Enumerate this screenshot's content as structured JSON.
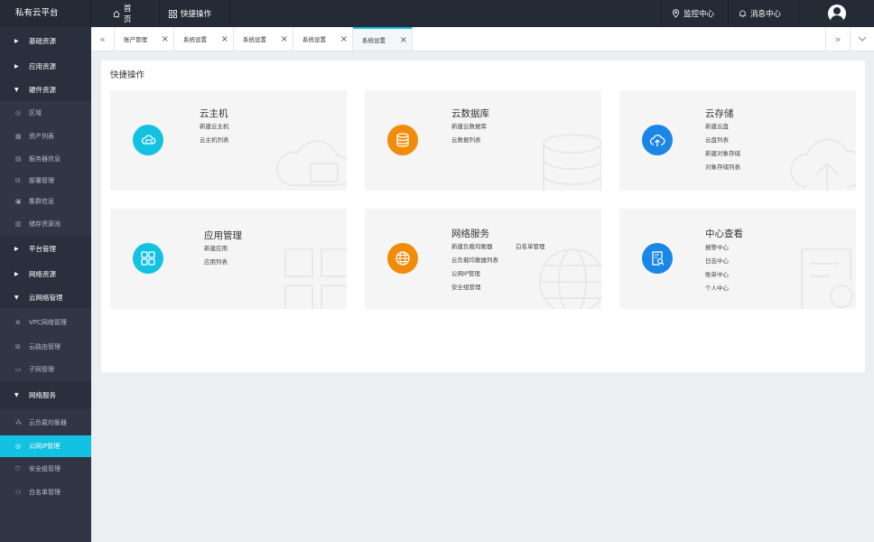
{
  "app": {
    "title": "私有云平台"
  },
  "topnav": {
    "home": "首页",
    "quick": "快捷操作",
    "monitor": "监控中心",
    "messages": "消息中心"
  },
  "sidebar": {
    "items": [
      {
        "type": "group",
        "label": "基础资源",
        "expanded": false
      },
      {
        "type": "group",
        "label": "应用资源",
        "expanded": false
      },
      {
        "type": "group",
        "label": "硬件资源",
        "expanded": true
      },
      {
        "type": "item",
        "label": "区域",
        "icon": "region-icon"
      },
      {
        "type": "item",
        "label": "资产列表",
        "icon": "asset-icon"
      },
      {
        "type": "item",
        "label": "服务器信息",
        "icon": "server-icon"
      },
      {
        "type": "item",
        "label": "部署管理",
        "icon": "deploy-icon"
      },
      {
        "type": "item",
        "label": "集群信息",
        "icon": "cluster-icon"
      },
      {
        "type": "item",
        "label": "储存资源池",
        "icon": "storage-pool-icon"
      },
      {
        "type": "group",
        "label": "平台管理",
        "expanded": false
      },
      {
        "type": "group",
        "label": "网络资源",
        "expanded": false
      },
      {
        "type": "group",
        "label": "云网络管理",
        "expanded": true
      },
      {
        "type": "item",
        "label": "VPC网络管理",
        "icon": "vpc-icon"
      },
      {
        "type": "item",
        "label": "云路由管理",
        "icon": "router-icon"
      },
      {
        "type": "item",
        "label": "子网管理",
        "icon": "subnet-icon"
      },
      {
        "type": "group",
        "label": "网络服务",
        "expanded": true
      },
      {
        "type": "item",
        "label": "云负载均衡器",
        "icon": "load-balancer-icon"
      },
      {
        "type": "item",
        "label": "公网IP管理",
        "icon": "public-ip-icon",
        "active": true
      },
      {
        "type": "item",
        "label": "安全组管理",
        "icon": "security-group-icon"
      },
      {
        "type": "item",
        "label": "白名单管理",
        "icon": "whitelist-icon"
      }
    ]
  },
  "tabs": [
    {
      "label": "账户管理"
    },
    {
      "label": "系统设置"
    },
    {
      "label": "系统设置"
    },
    {
      "label": "系统设置"
    },
    {
      "label": "系统设置",
      "active": true
    }
  ],
  "main": {
    "title": "快捷操作",
    "cards": [
      {
        "title": "云主机",
        "icon": "cloud-host-icon",
        "color": "#13c1e2",
        "links": [
          "新建云主机",
          "云主机列表"
        ]
      },
      {
        "title": "云数据库",
        "icon": "database-icon",
        "color": "#f08c0a",
        "links": [
          "新建云数据库",
          "云数据列表"
        ]
      },
      {
        "title": "云存储",
        "icon": "cloud-storage-icon",
        "color": "#1a86e6",
        "links": [
          "新建云盘",
          "云盘列表",
          "新建对象存储",
          "对象存储列表"
        ]
      },
      {
        "title": "应用管理",
        "icon": "app-grid-icon",
        "color": "#13c1e2",
        "links": [
          "新建应用",
          "应用列表"
        ]
      },
      {
        "title": "网络服务",
        "icon": "globe-icon",
        "color": "#f08c0a",
        "links": [
          "新建负载均衡器",
          "云负载均衡器列表",
          "公网IP管理",
          "安全组管理"
        ],
        "extra_link": "白名单管理"
      },
      {
        "title": "中心查看",
        "icon": "document-search-icon",
        "color": "#1a86e6",
        "links": [
          "报警中心",
          "日志中心",
          "账单中心",
          "个人中心"
        ]
      }
    ]
  }
}
